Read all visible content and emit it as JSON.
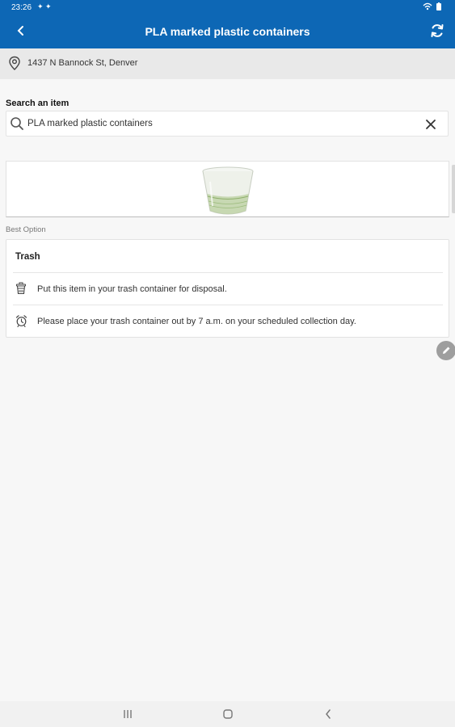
{
  "status_bar": {
    "time": "23:26",
    "indicators": "✦ ✦"
  },
  "header": {
    "title": "PLA marked plastic containers",
    "back_icon": "chevron-left-icon",
    "refresh_icon": "refresh-icon"
  },
  "address": {
    "text": "1437 N Bannock St, Denver",
    "icon": "location-pin-icon"
  },
  "search": {
    "label": "Search an item",
    "value": "PLA marked plastic containers",
    "icon": "search-icon",
    "clear_icon": "close-icon"
  },
  "result": {
    "best_option_label": "Best Option",
    "title": "Trash",
    "rows": [
      {
        "icon": "trash-can-icon",
        "text": "Put this item in your trash container for disposal."
      },
      {
        "icon": "alarm-clock-icon",
        "text": "Please place your trash container out by 7 a.m. on your scheduled collection day."
      }
    ]
  },
  "colors": {
    "header_bg": "#0d67b5",
    "address_bg": "#e9e9e9",
    "page_bg": "#f7f7f7"
  },
  "nav": {
    "recents_icon": "recents-icon",
    "home_icon": "home-icon",
    "back_icon": "back-icon"
  }
}
